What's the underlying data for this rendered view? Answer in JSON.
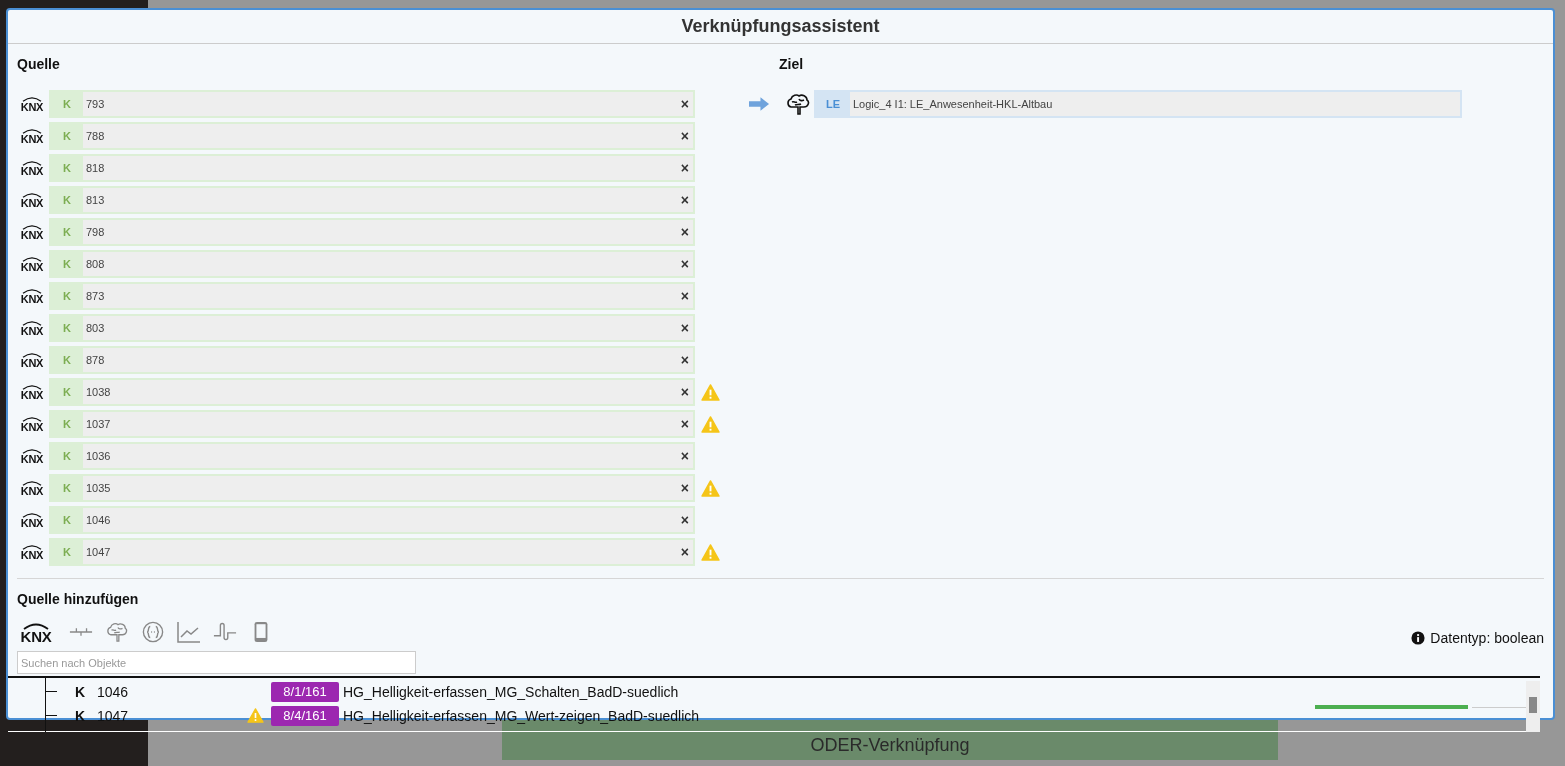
{
  "window": {
    "title": "Verknüpfungsassistent"
  },
  "source": {
    "heading": "Quelle",
    "items": [
      {
        "logo": "KNX",
        "badge": "K",
        "value": "793",
        "remove": "×",
        "warning": false
      },
      {
        "logo": "KNX",
        "badge": "K",
        "value": "788",
        "remove": "×",
        "warning": false
      },
      {
        "logo": "KNX",
        "badge": "K",
        "value": "818",
        "remove": "×",
        "warning": false
      },
      {
        "logo": "KNX",
        "badge": "K",
        "value": "813",
        "remove": "×",
        "warning": false
      },
      {
        "logo": "KNX",
        "badge": "K",
        "value": "798",
        "remove": "×",
        "warning": false
      },
      {
        "logo": "KNX",
        "badge": "K",
        "value": "808",
        "remove": "×",
        "warning": false
      },
      {
        "logo": "KNX",
        "badge": "K",
        "value": "873",
        "remove": "×",
        "warning": false
      },
      {
        "logo": "KNX",
        "badge": "K",
        "value": "803",
        "remove": "×",
        "warning": false
      },
      {
        "logo": "KNX",
        "badge": "K",
        "value": "878",
        "remove": "×",
        "warning": false
      },
      {
        "logo": "KNX",
        "badge": "K",
        "value": "1038",
        "remove": "×",
        "warning": true
      },
      {
        "logo": "KNX",
        "badge": "K",
        "value": "1037",
        "remove": "×",
        "warning": true
      },
      {
        "logo": "KNX",
        "badge": "K",
        "value": "1036",
        "remove": "×",
        "warning": false
      },
      {
        "logo": "KNX",
        "badge": "K",
        "value": "1035",
        "remove": "×",
        "warning": true
      },
      {
        "logo": "KNX",
        "badge": "K",
        "value": "1046",
        "remove": "×",
        "warning": false
      },
      {
        "logo": "KNX",
        "badge": "K",
        "value": "1047",
        "remove": "×",
        "warning": true
      }
    ]
  },
  "target": {
    "heading": "Ziel",
    "badge": "LE",
    "value": "Logic_4 I1: LE_Anwesenheit-HKL-Altbau"
  },
  "add_source": {
    "heading": "Quelle hinzufügen",
    "logo": "KNX",
    "search": {
      "placeholder": "Suchen nach Objekte"
    },
    "datatype": "Datentyp: boolean"
  },
  "dropdown": {
    "rows": [
      {
        "badge": "K",
        "number": "1046",
        "warning": false,
        "address": "8/1/161",
        "name": "HG_Helligkeit-erfassen_MG_Schalten_BadD-suedlich"
      },
      {
        "badge": "K",
        "number": "1047",
        "warning": true,
        "address": "8/4/161",
        "name": "HG_Helligkeit-erfassen_MG_Wert-zeigen_BadD-suedlich"
      }
    ]
  },
  "background": {
    "label": "ODER-Verknüpfung"
  }
}
